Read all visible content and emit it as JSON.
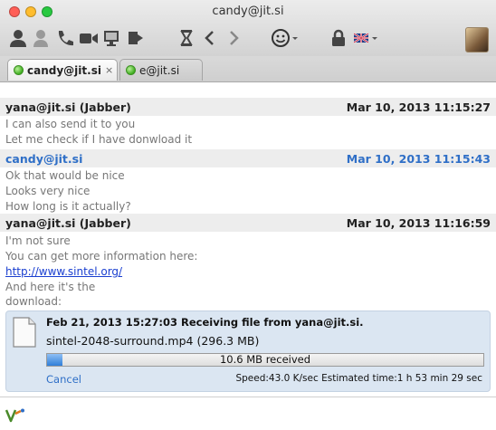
{
  "window": {
    "title": "candy@jit.si"
  },
  "toolbar": {
    "icons": [
      "contact-info-icon",
      "add-contact-icon",
      "phone-icon",
      "video-call-icon",
      "desktop-share-icon",
      "send-file-icon",
      "history-icon",
      "back-icon",
      "forward-icon",
      "smiley-icon",
      "lock-icon",
      "flag-icon"
    ]
  },
  "tabs": [
    {
      "label": "candy@jit.si",
      "active": true,
      "close": "×"
    },
    {
      "label": "e@jit.si",
      "active": false
    }
  ],
  "messages": [
    {
      "sender": "yana@jit.si (Jabber)",
      "time": "Mar 10, 2013 11:15:27",
      "lines": [
        "I can also send it to you",
        "Let me check if I have donwload it"
      ]
    },
    {
      "sender": "candy@jit.si",
      "time": "Mar 10, 2013 11:15:43",
      "lines": [
        "Ok that would be nice",
        "Looks very nice",
        "How long is it actually?"
      ]
    },
    {
      "sender": "yana@jit.si (Jabber)",
      "time": "Mar 10, 2013 11:16:59",
      "lines": [
        "I'm not sure",
        "You can get more information here:",
        "http://www.sintel.org/",
        "And here it's the",
        "download:"
      ]
    }
  ],
  "transfer": {
    "status": "Feb 21, 2013 15:27:03 Receiving file from yana@jit.si.",
    "filename": "sintel-2048-surround.mp4 (296.3 MB)",
    "received": "10.6 MB received",
    "progress_fraction": 0.036,
    "cancel": "Cancel",
    "stats": "Speed:43.0 K/sec  Estimated time:1 h 53 min 29 sec"
  },
  "colors": {
    "accent": "#2f6fc7",
    "link": "#1a3fd0",
    "header_bg": "#ededed",
    "transfer_bg": "#dbe6f2"
  }
}
